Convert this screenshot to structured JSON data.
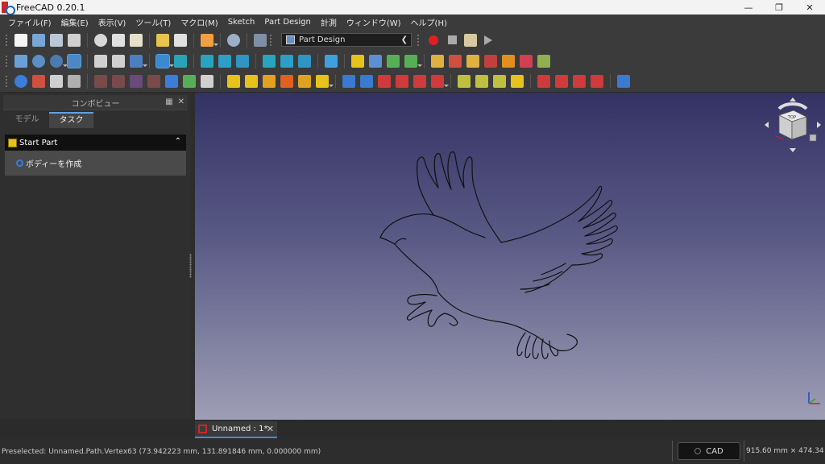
{
  "window": {
    "title": "FreeCAD 0.20.1"
  },
  "menubar": {
    "items": [
      "ファイル(F)",
      "編集(E)",
      "表示(V)",
      "ツール(T)",
      "マクロ(M)",
      "Sketch",
      "Part Design",
      "計測",
      "ウィンドウ(W)",
      "ヘルプ(H)"
    ]
  },
  "toolbar": {
    "workbench": "Part Design"
  },
  "combo": {
    "title": "コンボビュー",
    "tabs": [
      "モデル",
      "タスク"
    ],
    "active_tab": "タスク",
    "task_title": "Start Part",
    "task_action": "ボディーを作成"
  },
  "document_tab": {
    "label": "Unnamed : 1*"
  },
  "status": {
    "preselected": "Preselected: Unnamed.Path.Vertex63 (73.942223 mm, 131.891846 mm, 0.000000 mm)",
    "nav_style": "CAD",
    "dimensions": "915.60 mm × 474.34 mm"
  },
  "navcube": {
    "face_label": "TOP"
  },
  "colors": {
    "view_top": "#343264",
    "view_bottom": "#9e9eb6",
    "accent": "#3d8be0",
    "record": "#e02020"
  }
}
